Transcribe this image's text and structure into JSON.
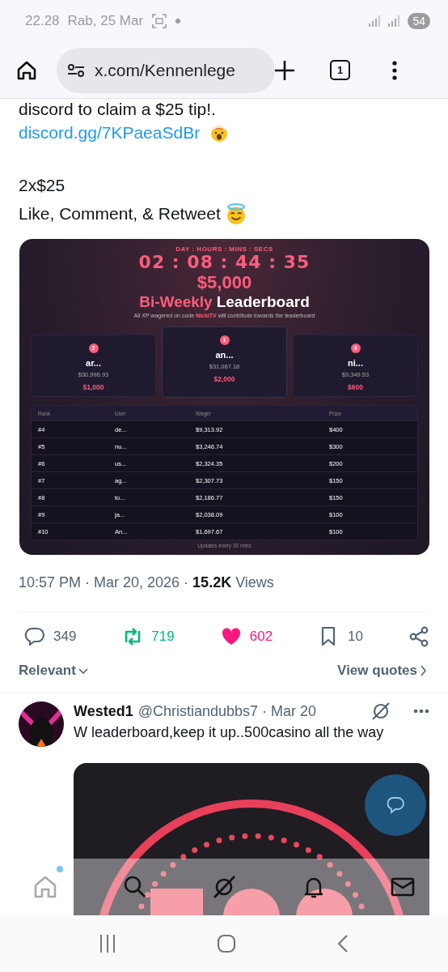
{
  "status_bar": {
    "time": "22.28",
    "date": "Rab, 25 Mar",
    "battery": "54"
  },
  "browser": {
    "url": "x.com/Kennenlege",
    "tab_count": "1"
  },
  "tweet": {
    "cut_line": "discord to claim a $25 tip!.",
    "link": "discord.gg/7KPaeaSdBr",
    "amount": "2x$25",
    "call_to_action": "Like, Comment, & Retweet"
  },
  "leaderboard": {
    "timer_label": "DAY : HOURS : MINS : SECS",
    "timer": "02 : 08 : 44 : 35",
    "pool": "$5,000",
    "title_accent": "Bi-Weekly",
    "title": "Leaderboard",
    "subtitle": "All XP wagered on code **NickiTV** will contribute towards the leaderboard",
    "podium": [
      {
        "place": "2",
        "user": "ar...",
        "wager": "$30,996.93",
        "prize": "$1,000",
        "featured": false
      },
      {
        "place": "1",
        "user": "an...",
        "wager": "$31,067.18",
        "prize": "$2,000",
        "featured": true
      },
      {
        "place": "3",
        "user": "ni...",
        "wager": "$9,349.53",
        "prize": "$600",
        "featured": false
      }
    ],
    "columns": [
      "Rank",
      "User",
      "Wager",
      "Prize"
    ],
    "rows": [
      [
        "#4",
        "de...",
        "$9,313.92",
        "$400"
      ],
      [
        "#5",
        "nu...",
        "$3,246.74",
        "$300"
      ],
      [
        "#6",
        "us...",
        "$2,324.35",
        "$200"
      ],
      [
        "#7",
        "ag...",
        "$2,307.73",
        "$150"
      ],
      [
        "#8",
        "to...",
        "$2,186.77",
        "$150"
      ],
      [
        "#9",
        "ja...",
        "$2,038.09",
        "$100"
      ],
      [
        "#10",
        "An...",
        "$1,697.67",
        "$100"
      ]
    ],
    "footer": "Updates every 30 mins"
  },
  "meta": "10:57 PM · Mar 20, 2026 · **15.2K** Views",
  "actions": [
    {
      "kind": "reply",
      "count": "349",
      "active": false
    },
    {
      "kind": "repost",
      "count": "719",
      "active": true
    },
    {
      "kind": "like",
      "count": "602",
      "active": true
    },
    {
      "kind": "bookmark",
      "count": "10",
      "active": false
    },
    {
      "kind": "share",
      "active": false
    }
  ],
  "sort": {
    "label": "Relevant",
    "quotes": "View quotes"
  },
  "reply": {
    "name": "Wested1",
    "handle_date": "@Christiandubbs7 · Mar 20",
    "text": "W leaderboard,keep it up..500casino all the way"
  },
  "bottom_nav": [
    {
      "kind": "home",
      "unread": true
    },
    {
      "kind": "search",
      "unread": false
    },
    {
      "kind": "grok",
      "unread": false
    },
    {
      "kind": "notifications",
      "unread": false
    },
    {
      "kind": "messages",
      "unread": false
    }
  ]
}
